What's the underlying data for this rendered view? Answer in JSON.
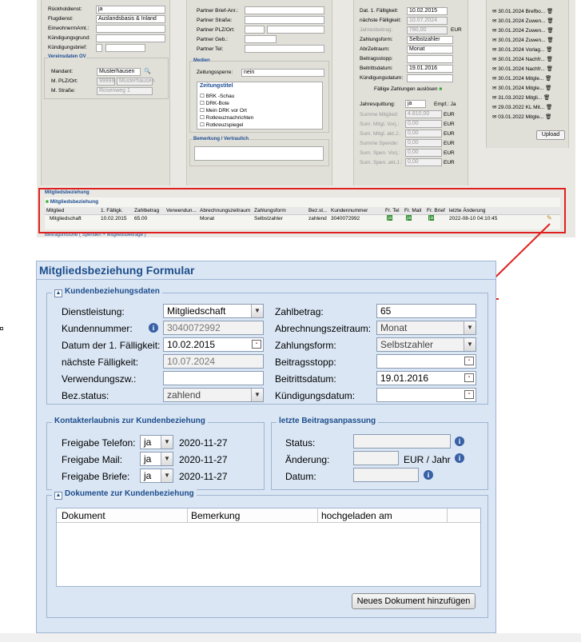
{
  "bg": {
    "col1": {
      "rows": [
        {
          "label": "Rückholdienst:",
          "value": "ja"
        },
        {
          "label": "Flugdienst:",
          "value": "Auslandsbasis & Inland"
        },
        {
          "label": "EinwohnermAmt.:",
          "value": ""
        },
        {
          "label": "Kündigungsgrund:",
          "value": ""
        },
        {
          "label": "Kündigungsbrief:",
          "value": ""
        }
      ],
      "section_title": "Vereinsdaten OV",
      "mandant_label": "Mandant:",
      "mandant_value": "Musterhausen",
      "plz_label": "M. PLZ/Ort:",
      "plz_value": "99999",
      "ort_value": "Musterhausen",
      "strasse_label": "M. Straße:",
      "strasse_value": "Rosenweg 1"
    },
    "col2": {
      "rows": [
        "Partner Brief-Anr.:",
        "Partner Straße:",
        "Partner PLZ/Ort:",
        "Partner Geb.:",
        "Partner Tel:"
      ],
      "medien_title": "Medien",
      "sperre_label": "Zeitungssperre:",
      "sperre_value": "nein",
      "zeitungstitel_title": "Zeitungstitel",
      "zeitungen": [
        "BRK -Schau",
        "DRK-Bote",
        "Mein DRK vor Ort",
        "Rotkreuznachrichten",
        "Rotkreuzspiegel"
      ],
      "bemerkung_title": "Bemerkung / Vertraulich"
    },
    "col3": {
      "rows": [
        {
          "label": "Dat. 1. Fälligkeit:",
          "value": "10.02.2015"
        },
        {
          "label": "nächste Fälligkeit:",
          "value": "10.07.2024"
        },
        {
          "label": "Jahresbeitrag:",
          "value": "780,00",
          "unit": "EUR"
        },
        {
          "label": "Zahlungsform:",
          "value": "Selbstzahler"
        },
        {
          "label": "AbrZeitraum:",
          "value": "Monat"
        },
        {
          "label": "Beitragsstopp:",
          "value": ""
        },
        {
          "label": "Beitrittsdatum:",
          "value": "19.01.2016"
        },
        {
          "label": "Kündigungsdatum:",
          "value": ""
        }
      ],
      "button": "Fällige Zahlungen auslösen",
      "quittung_label": "Jahresquittung:",
      "quittung_value": "ja",
      "empf": "Empf.: Ja",
      "sums": [
        {
          "label": "Summe Mitglied:",
          "value": "4.810,00",
          "unit": "EUR"
        },
        {
          "label": "Sum. Mitgl. Vorj.:",
          "value": "0,00",
          "unit": "EUR"
        },
        {
          "label": "Sum. Mitgl. akt.J.:",
          "value": "0,00",
          "unit": "EUR"
        },
        {
          "label": "Summe Spende:",
          "value": "0,00",
          "unit": "EUR"
        },
        {
          "label": "Sum. Spen. Vorj.:",
          "value": "0,00",
          "unit": "EUR"
        },
        {
          "label": "Sum. Spen. akt.J.:",
          "value": "0,00",
          "unit": "EUR"
        }
      ]
    },
    "col4": {
      "docs": [
        "30.01.2024 Brefbo...",
        "30.01.2024 Zuwen...",
        "30.01.2024 Zuwen...",
        "30.01.2024 Zuwen...",
        "30.01.2024 Vorlag...",
        "30.01.2024 Nachfr...",
        "30.01.2024 Nachfr...",
        "30.01.2024 Mitgle...",
        "30.01.2024 Mitgle...",
        "31.03.2022 Mitgli...",
        "29.03.2022 KL Mit...",
        "03.01.2022 Mitgle..."
      ],
      "upload": "Upload"
    },
    "mitglied": {
      "section": "Mitgliedsbeziehung",
      "panel_title": "Mitgliedsbeziehung",
      "headers": [
        "Mitglied",
        "1. Fälligk.",
        "Zahlbetrag",
        "Verwendun...",
        "Abrechnungszeitraum",
        "Zahlungsform",
        "Bez.st...",
        "Kundennummer",
        "Fr. Tel",
        "Fr. Mail",
        "Fr. Brief",
        "letzte Änderung"
      ],
      "row": [
        "Mitgliedschaft",
        "10.02.2015",
        "65.00",
        "",
        "Monat",
        "Selbstzahler",
        "zahlend",
        "3040072992",
        "ja",
        "ja",
        "ja",
        "2022-08-10 04:10:45"
      ],
      "historie": "Beitragshistorie ( Spenden + Mitgliedsbeiträge )"
    }
  },
  "form": {
    "title": "Mitgliedsbeziehung Formular",
    "kunden": {
      "legend": "Kundenbeziehungsdaten",
      "left": [
        {
          "label": "Dienstleistung:",
          "value": "Mitgliedschaft"
        },
        {
          "label": "Kundennummer:",
          "value": "3040072992"
        },
        {
          "label": "Datum der 1. Fälligkeit:",
          "value": "10.02.2015"
        },
        {
          "label": "nächste Fälligkeit:",
          "value": "10.07.2024"
        },
        {
          "label": "Verwendungszw.:",
          "value": ""
        },
        {
          "label": "Bez.status:",
          "value": "zahlend"
        }
      ],
      "right": [
        {
          "label": "Zahlbetrag:",
          "value": "65"
        },
        {
          "label": "Abrechnungszeitraum:",
          "value": "Monat"
        },
        {
          "label": "Zahlungsform:",
          "value": "Selbstzahler"
        },
        {
          "label": "Beitragsstopp:",
          "value": ""
        },
        {
          "label": "Beitrittsdatum:",
          "value": "19.01.2016"
        },
        {
          "label": "Kündigungsdatum:",
          "value": ""
        }
      ]
    },
    "kontakt": {
      "legend": "Kontakterlaubnis zur Kundenbeziehung",
      "rows": [
        {
          "label": "Freigabe Telefon:",
          "value": "ja",
          "date": "2020-11-27"
        },
        {
          "label": "Freigabe Mail:",
          "value": "ja",
          "date": "2020-11-27"
        },
        {
          "label": "Freigabe Briefe:",
          "value": "ja",
          "date": "2020-11-27"
        }
      ]
    },
    "anpassung": {
      "legend": "letzte Beitragsanpassung",
      "status_label": "Status:",
      "aenderung_label": "Änderung:",
      "unit": "EUR / Jahr",
      "datum_label": "Datum:"
    },
    "dokumente": {
      "legend": "Dokumente zur Kundenbeziehung",
      "columns": [
        "Dokument",
        "Bemerkung",
        "hochgeladen am"
      ],
      "add_button": "Neues Dokument hinzufügen"
    }
  },
  "colors": {
    "highlight": "#e02020",
    "form_bg": "#dae6f4",
    "title": "#1e4e8c"
  }
}
